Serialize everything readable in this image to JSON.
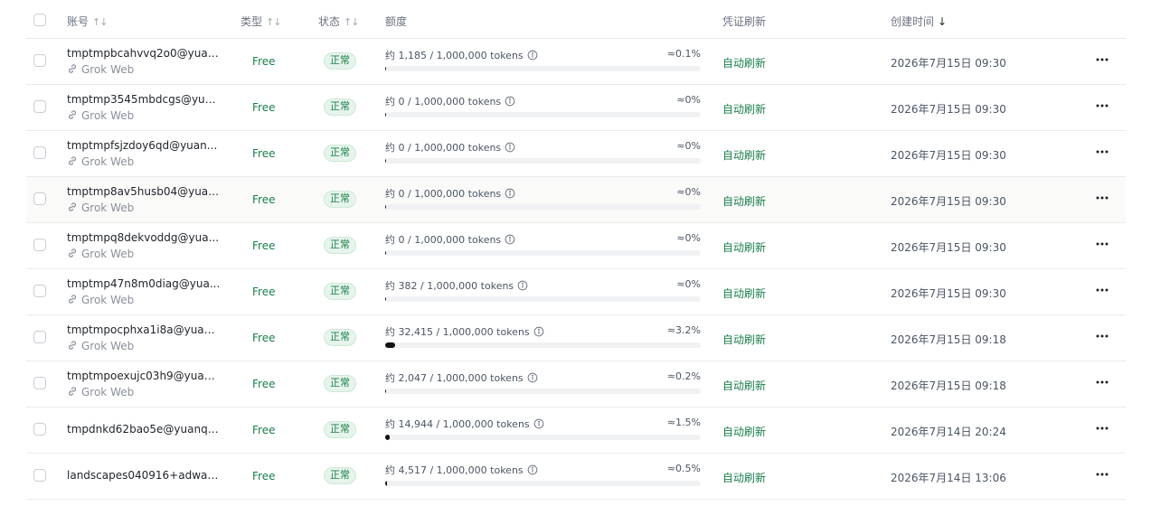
{
  "headers": {
    "account": "账号",
    "type": "类型",
    "status": "状态",
    "quota": "额度",
    "credential_refresh": "凭证刷新",
    "created_at": "创建时间",
    "sort_icon": "sort-icon",
    "sort_desc_icon": "arrow-down-icon"
  },
  "colors": {
    "accent_green": "#1a7f4b",
    "status_bg": "#e6f4ec",
    "bar_fill": "#111111",
    "bar_track": "#f0f1f3"
  },
  "rows": [
    {
      "email": "tmptmpbcahvvq2o0@yuan...",
      "source": "Grok Web",
      "type": "Free",
      "status": "正常",
      "quota_text": "约 1,185 / 1,000,000 tokens",
      "quota_pct": "≈0.1%",
      "quota_fraction": 0.001185,
      "refresh": "自动刷新",
      "created": "2026年7月15日 09:30"
    },
    {
      "email": "tmptmp3545mbdcgs@yua...",
      "source": "Grok Web",
      "type": "Free",
      "status": "正常",
      "quota_text": "约 0 / 1,000,000 tokens",
      "quota_pct": "≈0%",
      "quota_fraction": 0,
      "refresh": "自动刷新",
      "created": "2026年7月15日 09:30"
    },
    {
      "email": "tmptmpfsjzdoy6qd@yuan...",
      "source": "Grok Web",
      "type": "Free",
      "status": "正常",
      "quota_text": "约 0 / 1,000,000 tokens",
      "quota_pct": "≈0%",
      "quota_fraction": 0,
      "refresh": "自动刷新",
      "created": "2026年7月15日 09:30"
    },
    {
      "email": "tmptmp8av5husb04@yuan...",
      "source": "Grok Web",
      "type": "Free",
      "status": "正常",
      "quota_text": "约 0 / 1,000,000 tokens",
      "quota_pct": "≈0%",
      "quota_fraction": 0,
      "refresh": "自动刷新",
      "created": "2026年7月15日 09:30"
    },
    {
      "email": "tmptmpq8dekvoddg@yua...",
      "source": "Grok Web",
      "type": "Free",
      "status": "正常",
      "quota_text": "约 0 / 1,000,000 tokens",
      "quota_pct": "≈0%",
      "quota_fraction": 0,
      "refresh": "自动刷新",
      "created": "2026年7月15日 09:30"
    },
    {
      "email": "tmptmp47n8m0diag@yua...",
      "source": "Grok Web",
      "type": "Free",
      "status": "正常",
      "quota_text": "约 382 / 1,000,000 tokens",
      "quota_pct": "≈0%",
      "quota_fraction": 0.000382,
      "refresh": "自动刷新",
      "created": "2026年7月15日 09:30"
    },
    {
      "email": "tmptmpocphxa1i8a@yuan...",
      "source": "Grok Web",
      "type": "Free",
      "status": "正常",
      "quota_text": "约 32,415 / 1,000,000 tokens",
      "quota_pct": "≈3.2%",
      "quota_fraction": 0.032415,
      "refresh": "自动刷新",
      "created": "2026年7月15日 09:18"
    },
    {
      "email": "tmptmpoexujc03h9@yuan...",
      "source": "Grok Web",
      "type": "Free",
      "status": "正常",
      "quota_text": "约 2,047 / 1,000,000 tokens",
      "quota_pct": "≈0.2%",
      "quota_fraction": 0.002047,
      "refresh": "自动刷新",
      "created": "2026年7月15日 09:18"
    },
    {
      "email": "tmpdnkd62bao5e@yuanqi...",
      "source": "",
      "type": "Free",
      "status": "正常",
      "quota_text": "约 14,944 / 1,000,000 tokens",
      "quota_pct": "≈1.5%",
      "quota_fraction": 0.014944,
      "refresh": "自动刷新",
      "created": "2026年7月14日 20:24"
    },
    {
      "email": "landscapes040916+adwad...",
      "source": "",
      "type": "Free",
      "status": "正常",
      "quota_text": "约 4,517 / 1,000,000 tokens",
      "quota_pct": "≈0.5%",
      "quota_fraction": 0.004517,
      "refresh": "自动刷新",
      "created": "2026年7月14日 13:06"
    }
  ]
}
